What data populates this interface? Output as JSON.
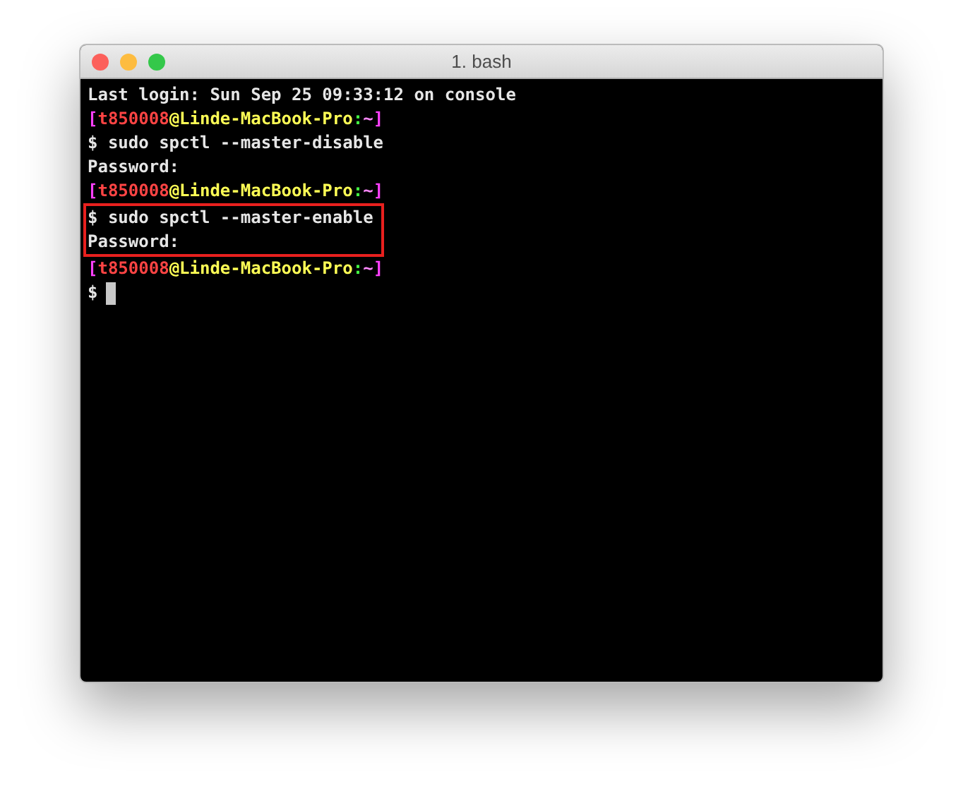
{
  "window": {
    "title": "1. bash"
  },
  "lines": [
    {
      "kind": "text",
      "text": "Last login: Sun Sep 25 09:33:12 on console",
      "highlighted": false
    },
    {
      "kind": "prompt",
      "highlighted": false,
      "segments": [
        {
          "text": "[",
          "color": "#ff40ff"
        },
        {
          "text": "t850008",
          "color": "#ff4444"
        },
        {
          "text": "@Linde-MacBook-Pro",
          "color": "#ffff55"
        },
        {
          "text": ":",
          "color": "#44ff44"
        },
        {
          "text": "~",
          "color": "#ff88ff"
        },
        {
          "text": "]",
          "color": "#ff40ff"
        }
      ]
    },
    {
      "kind": "text",
      "text": "$ sudo spctl --master-disable",
      "highlighted": false
    },
    {
      "kind": "text",
      "text": "Password:",
      "highlighted": false
    },
    {
      "kind": "prompt",
      "highlighted": false,
      "segments": [
        {
          "text": "[",
          "color": "#ff40ff"
        },
        {
          "text": "t850008",
          "color": "#ff4444"
        },
        {
          "text": "@Linde-MacBook-Pro",
          "color": "#ffff55"
        },
        {
          "text": ":",
          "color": "#44ff44"
        },
        {
          "text": "~",
          "color": "#ff88ff"
        },
        {
          "text": "]",
          "color": "#ff40ff"
        }
      ]
    },
    {
      "kind": "text",
      "text": "$ sudo spctl --master-enable",
      "highlighted": true
    },
    {
      "kind": "text",
      "text": "Password:",
      "highlighted": true
    },
    {
      "kind": "prompt",
      "highlighted": false,
      "segments": [
        {
          "text": "[",
          "color": "#ff40ff"
        },
        {
          "text": "t850008",
          "color": "#ff4444"
        },
        {
          "text": "@Linde-MacBook-Pro",
          "color": "#ffff55"
        },
        {
          "text": ":",
          "color": "#44ff44"
        },
        {
          "text": "~",
          "color": "#ff88ff"
        },
        {
          "text": "]",
          "color": "#ff40ff"
        }
      ]
    },
    {
      "kind": "input",
      "text": "$"
    }
  ]
}
